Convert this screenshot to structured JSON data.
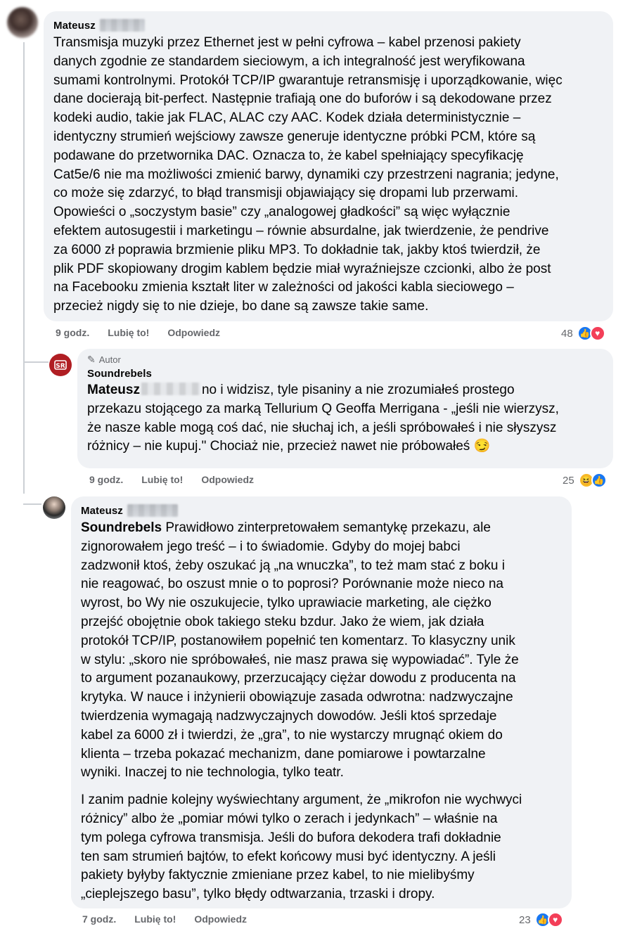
{
  "comments": [
    {
      "author": "Mateusz",
      "text": "Transmisja muzyki przez Ethernet jest w pełni cyfrowa – kabel przenosi pakiety\ndanych zgodnie ze standardem sieciowym, a ich integralność jest weryfikowana\nsumami kontrolnymi. Protokół TCP/IP gwarantuje retransmisję i uporządkowanie, więc\ndane docierają bit-perfect. Następnie trafiają one do buforów i są dekodowane przez\nkodeki audio, takie jak FLAC, ALAC czy AAC. Kodek działa deterministycznie –\nidentyczny strumień wejściowy zawsze generuje identyczne próbki PCM, które są\npodawane do przetwornika DAC. Oznacza to, że kabel spełniający specyfikację\nCat5e/6 nie ma możliwości zmienić barwy, dynamiki czy przestrzeni nagrania; jedyne,\nco może się zdarzyć, to błąd transmisji objawiający się dropami lub przerwami.\nOpowieści o „soczystym basie” czy „analogowej gładkości” są więc wyłącznie\nefektem autosugestii i marketingu – równie absurdalne, jak twierdzenie, że pendrive\nza 6000 zł poprawia brzmienie pliku MP3. To dokładnie tak, jakby ktoś twierdził, że\nplik PDF skopiowany drogim kablem będzie miał wyraźniejsze czcionki, albo że post\nna Facebooku zmienia kształt liter w zależności od jakości kabla sieciowego –\nprzecież nigdy się to nie dzieje, bo dane są zawsze takie same.",
      "time": "9 godz.",
      "like": "Lubię to!",
      "reply": "Odpowiedz",
      "reaction_count": "48"
    },
    {
      "badge": "Autor",
      "author": "Soundrebels",
      "mention": "Mateusz",
      "text_first": "no i widzisz, tyle pisaniny a nie zrozumiałeś prostego",
      "text": "przekazu stojącego za marką Tellurium Q Geoffa Merrigana - „jeśli nie wierzysz,\nże nasze kable mogą coś dać, nie słuchaj ich, a jeśli spróbowałeś i nie słyszysz\nróżnicy – nie kupuj.\" Chociaż nie, przecież nawet nie próbowałeś 😏",
      "time": "9 godz.",
      "like": "Lubię to!",
      "reply": "Odpowiedz",
      "reaction_count": "25"
    },
    {
      "author": "Mateusz",
      "mention": "Soundrebels",
      "text_first": " Prawidłowo zinterpretowałem semantykę przekazu, ale",
      "text": "zignorowałem jego treść – i to świadomie. Gdyby do mojej babci\nzadzwonił ktoś, żeby oszukać ją „na wnuczka”, to też mam stać z boku i\nnie reagować, bo oszust mnie o to poprosi? Porównanie może nieco na\nwyrost, bo Wy nie oszukujecie, tylko uprawiacie marketing, ale ciężko\nprzejść obojętnie obok takiego steku bzdur. Jako że wiem, jak działa\nprotokół TCP/IP, postanowiłem popełnić ten komentarz. To klasyczny unik\nw stylu: „skoro nie spróbowałeś, nie masz prawa się wypowiadać”. Tyle że\nto argument pozanaukowy, przerzucający ciężar dowodu z producenta na\nkrytyka. W nauce i inżynierii obowiązuje zasada odwrotna: nadzwyczajne\ntwierdzenia wymagają nadzwyczajnych dowodów. Jeśli ktoś sprzedaje\nkabel za 6000 zł i twierdzi, że „gra”, to nie wystarczy mrugnąć okiem do\nklienta – trzeba pokazać mechanizm, dane pomiarowe i powtarzalne\nwyniki. Inaczej to nie technologia, tylko teatr.",
      "text2": "I zanim padnie kolejny wyświechtany argument, że „mikrofon nie wychwyci\nróżnicy” albo że „pomiar mówi tylko o zerach i jedynkach” – właśnie na\ntym polega cyfrowa transmisja. Jeśli do bufora dekodera trafi dokładnie\nten sam strumień bajtów, to efekt końcowy musi być identyczny. A jeśli\npakiety byłyby faktycznie zmieniane przez kabel, to nie mielibyśmy\n„cieplejszego basu”, tylko błędy odtwarzania, trzaski i dropy.",
      "time": "7 godz.",
      "like": "Lubię to!",
      "reply": "Odpowiedz",
      "reaction_count": "23"
    }
  ],
  "icons": {
    "like": "like-icon",
    "love": "love-icon",
    "haha": "haha-icon",
    "pencil": "pencil-icon"
  },
  "colors": {
    "bubble": "#f0f2f5",
    "like": "#1877f2",
    "love": "#f33e58",
    "brand_logo": "#b01e23"
  }
}
